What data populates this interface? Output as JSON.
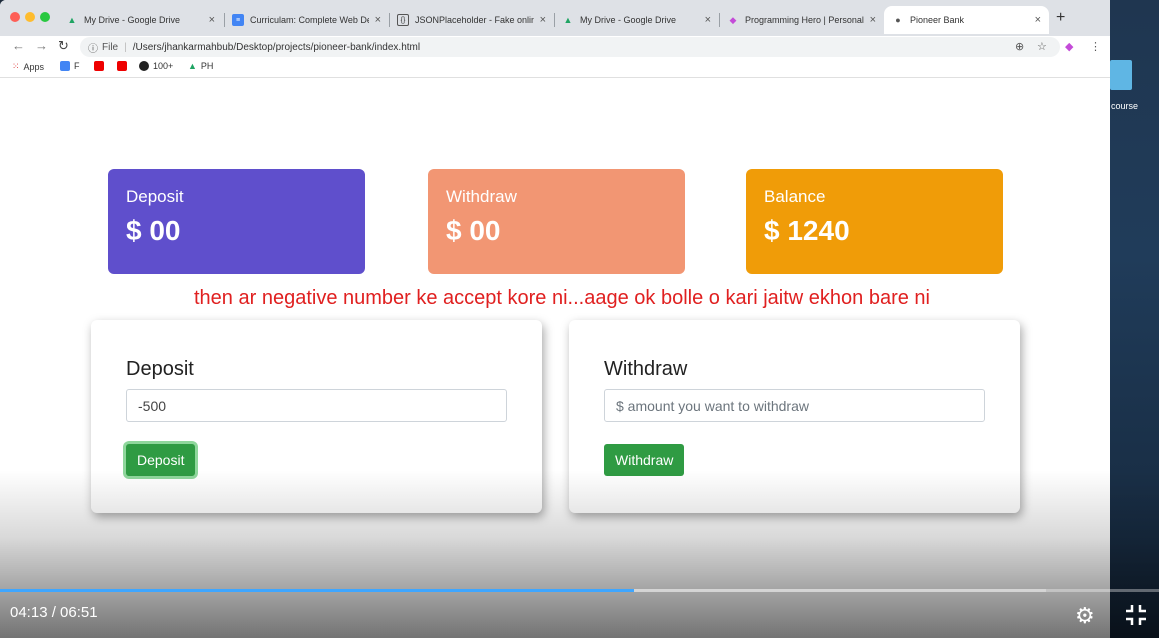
{
  "browser": {
    "tabs": [
      {
        "title": "My Drive - Google Drive",
        "icon": "google-drive-icon"
      },
      {
        "title": "Curriculam: Complete Web Dev",
        "icon": "google-docs-icon"
      },
      {
        "title": "JSONPlaceholder - Fake online",
        "icon": "json-placeholder-icon"
      },
      {
        "title": "My Drive - Google Drive",
        "icon": "google-drive-icon"
      },
      {
        "title": "Programming Hero | Personal",
        "icon": "programming-hero-icon"
      },
      {
        "title": "Pioneer Bank",
        "icon": "globe-icon"
      }
    ],
    "address": {
      "scheme_label": "File",
      "url": "/Users/jhankarmahbub/Desktop/projects/pioneer-bank/index.html"
    },
    "bookmarks": [
      {
        "label": "Apps",
        "icon": "apps-grid-icon"
      },
      {
        "label": "F",
        "icon": "google-docs-icon"
      },
      {
        "label": "",
        "icon": "youtube-icon"
      },
      {
        "label": "",
        "icon": "youtube-icon"
      },
      {
        "label": "100+",
        "icon": "github-icon"
      },
      {
        "label": "PH",
        "icon": "google-drive-icon"
      }
    ]
  },
  "desktop": {
    "icon_label": "course"
  },
  "stats": {
    "deposit": {
      "label": "Deposit",
      "value": "$ 00",
      "color": "#5f4fcc"
    },
    "withdraw": {
      "label": "Withdraw",
      "value": "$ 00",
      "color": "#f29673"
    },
    "balance": {
      "label": "Balance",
      "value": "$ 1240",
      "color": "#f09c08"
    }
  },
  "caption": "then ar negative number ke accept kore ni...aage ok bolle o kari jaitw ekhon bare ni",
  "deposit_card": {
    "title": "Deposit",
    "input_value": "-500",
    "button_label": "Deposit"
  },
  "withdraw_card": {
    "title": "Withdraw",
    "input_placeholder": "$ amount you want to withdraw",
    "button_label": "Withdraw"
  },
  "video": {
    "time_current": "04:13",
    "time_total": "06:51",
    "time_display": "04:13 / 06:51",
    "progress_fraction": 0.547,
    "accent_color": "#3ea6ff"
  }
}
